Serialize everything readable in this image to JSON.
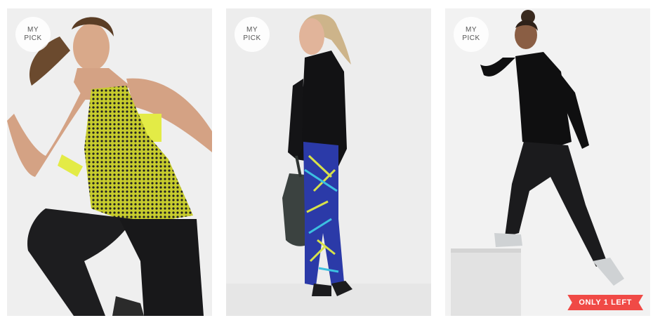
{
  "products": [
    {
      "pick_label": "MY\nPICK",
      "image": "woman-mesh-tank-running-photo"
    },
    {
      "pick_label": "MY\nPICK",
      "image": "woman-printed-leggings-backpack-photo"
    },
    {
      "pick_label": "MY\nPICK",
      "image": "woman-black-top-step-up-photo",
      "badge": "ONLY 1 LEFT"
    }
  ],
  "colors": {
    "badge_bg": "#f04a46",
    "photo_bg": "#ececec",
    "pick_bg": "#ffffff",
    "pick_text": "#555555"
  }
}
